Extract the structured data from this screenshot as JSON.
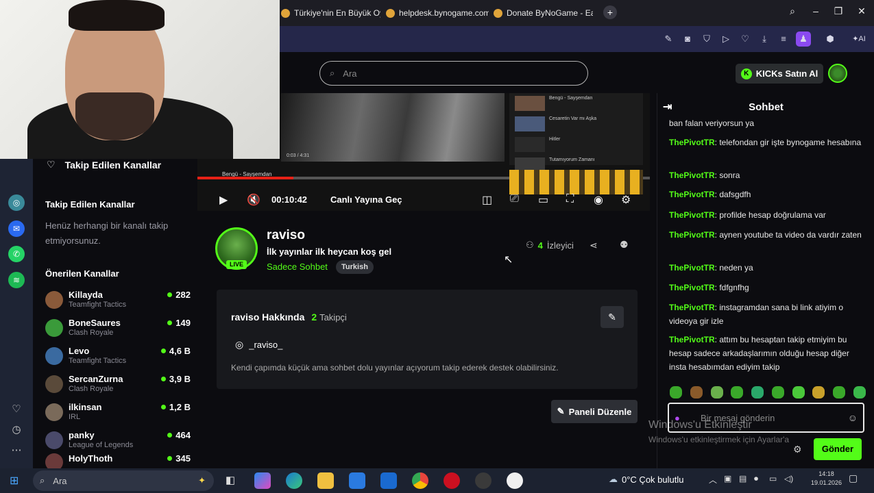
{
  "browser": {
    "tabs": [
      {
        "title": "Türkiye'nin En Büyük Oyu"
      },
      {
        "title": "helpdesk.bynogame.com/"
      },
      {
        "title": "Donate ByNoGame - Eas"
      }
    ],
    "ai_label": "AI"
  },
  "search": {
    "placeholder": "Ara"
  },
  "header": {
    "kicks_button": "KICKs Satın Al"
  },
  "sidebar": {
    "followed_header": "Takip Edilen Kanallar",
    "followed_title": "Takip Edilen Kanallar",
    "empty_text": "Henüz herhangi bir kanalı takip etmiyorsunuz.",
    "recommended_title": "Önerilen Kanallar",
    "channels": [
      {
        "name": "Killayda",
        "game": "Teamfight Tactics",
        "viewers": "282",
        "color": "#8a5a3a"
      },
      {
        "name": "BoneSaures",
        "game": "Clash Royale",
        "viewers": "149",
        "color": "#3a9a3a"
      },
      {
        "name": "Levo",
        "game": "Teamfight Tactics",
        "viewers": "4,6 B",
        "color": "#3a6aa0"
      },
      {
        "name": "SercanZurna",
        "game": "Clash Royale",
        "viewers": "3,9 B",
        "color": "#5a4a3a"
      },
      {
        "name": "ilkinsan",
        "game": "IRL",
        "viewers": "1,2 B",
        "color": "#7a6a5a"
      },
      {
        "name": "panky",
        "game": "League of Legends",
        "viewers": "464",
        "color": "#4a4a6a"
      },
      {
        "name": "HolyThoth",
        "game": "",
        "viewers": "345",
        "color": "#6a3a3a"
      }
    ]
  },
  "player": {
    "time": "00:10:42",
    "go_live": "Canlı Yayına Geç",
    "yt_title": "Bengü - Sayşemdan",
    "yt_time": "0:03 / 4:31",
    "yt_sidebar": [
      {
        "title": "Bengü - Sayşemdan"
      },
      {
        "title": "Cesaretin Var mı Aşka"
      },
      {
        "title": "Hitler"
      },
      {
        "title": "Tutamıyorum Zamanı"
      }
    ]
  },
  "channel": {
    "name": "raviso",
    "stream_title": "İlk yayınlar ilk heycan koş gel",
    "category": "Sadece Sohbet",
    "tag": "Turkish",
    "viewers_count": "4",
    "viewers_label": "İzleyici",
    "live_badge": "LIVE"
  },
  "about": {
    "title": "raviso Hakkında",
    "followers_count": "2",
    "followers_label": "Takipçi",
    "instagram": "_raviso_",
    "description": "Kendi çapımda küçük ama sohbet dolu yayınlar açıyorum takip ederek destek olabilirsiniz.",
    "edit_panel_button": "Paneli Düzenle"
  },
  "chat": {
    "title": "Sohbet",
    "messages": [
      {
        "user": "",
        "text": "ban falan veriyorsun ya"
      },
      {
        "user": "ThePivotTR",
        "text": "telefondan gir işte bynogame hesabına"
      },
      {
        "user": "ThePivotTR",
        "text": "sonra"
      },
      {
        "user": "ThePivotTR",
        "text": "dafsgdfh"
      },
      {
        "user": "ThePivotTR",
        "text": "profilde hesap doğrulama var"
      },
      {
        "user": "ThePivotTR",
        "text": "aynen youtube ta video da vardır zaten"
      },
      {
        "user": "ThePivotTR",
        "text": "neden ya"
      },
      {
        "user": "ThePivotTR",
        "text": "fdfgnfhg"
      },
      {
        "user": "ThePivotTR",
        "text": "instagramdan sana bi link atiyim o videoya gir izle"
      },
      {
        "user": "ThePivotTR",
        "text": "attım bu hesaptan takip etmiyim bu hesap sadece arkadaşlarımın olduğu hesap diğer insta hesabımdan ediyim takip"
      }
    ],
    "input_placeholder": "Bir mesaj gönderin",
    "send_button": "Gönder"
  },
  "windows_watermark": {
    "line1": "Windows'u Etkinleştir",
    "line2": "Windows'u etkinleştirmek için Ayarlar'a"
  },
  "taskbar": {
    "search_placeholder": "Ara",
    "weather": "0°C  Çok bulutlu",
    "time": "14:18",
    "date": "19.01.2026"
  }
}
